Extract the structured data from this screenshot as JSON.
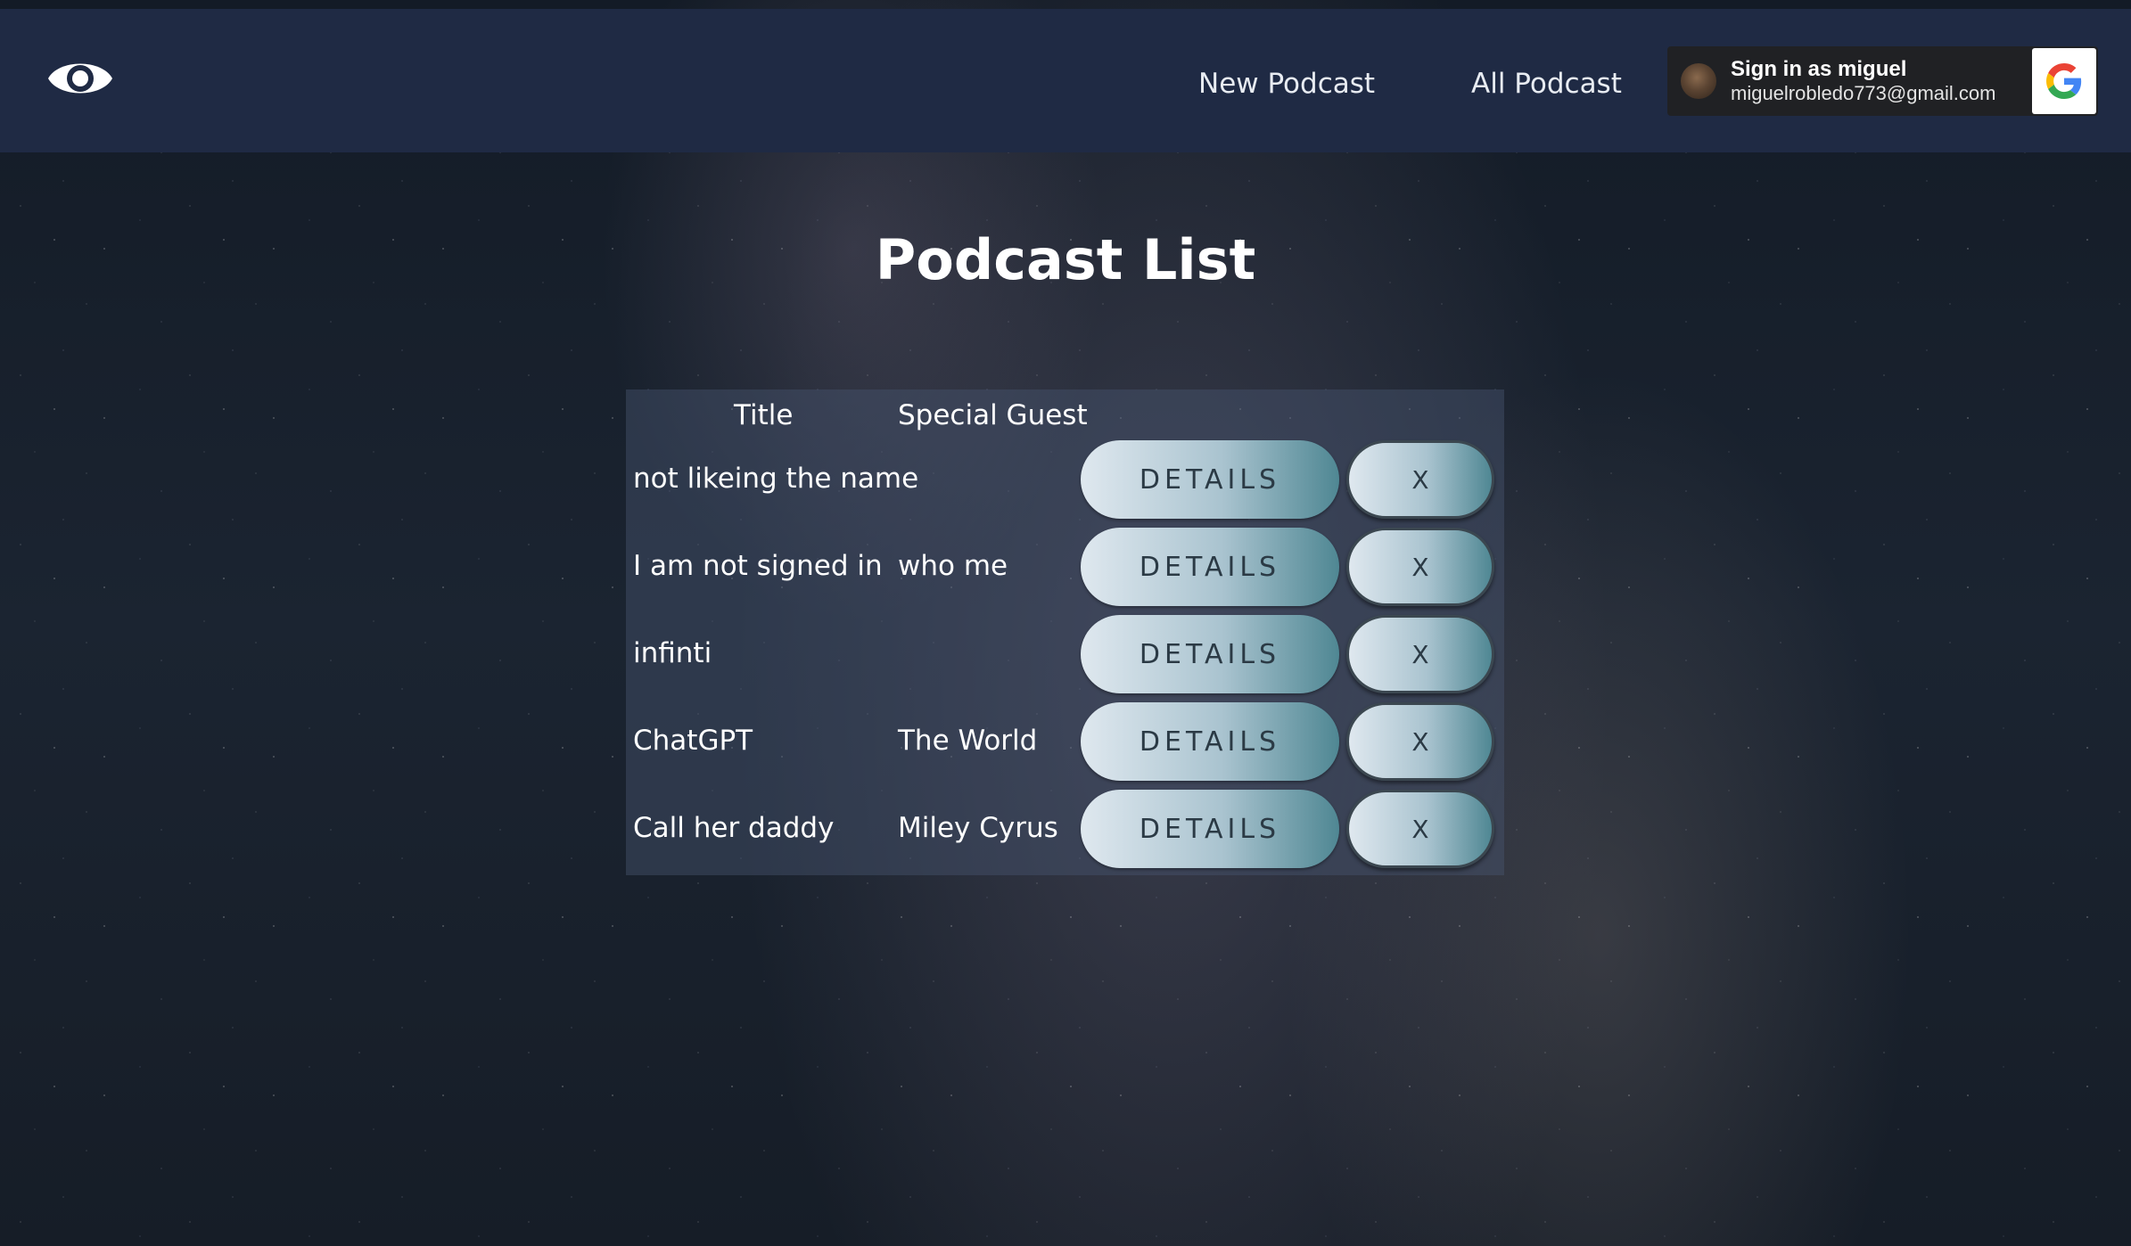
{
  "nav": {
    "logo_icon": "eye-icon",
    "links": [
      "New Podcast",
      "All Podcast"
    ]
  },
  "signin": {
    "label": "Sign in as miguel",
    "email": "miguelrobledo773@gmail.com",
    "provider_icon": "google-icon"
  },
  "page": {
    "title": "Podcast List"
  },
  "table": {
    "headers": [
      "Title",
      "Special Guest"
    ],
    "rows": [
      {
        "title": "not likeing the name",
        "guest": "",
        "details": "DETAILS",
        "delete": "X"
      },
      {
        "title": "I am not signed in",
        "guest": "who me",
        "details": "DETAILS",
        "delete": "X"
      },
      {
        "title": "infinti",
        "guest": "",
        "details": "DETAILS",
        "delete": "X"
      },
      {
        "title": "ChatGPT",
        "guest": "The World",
        "details": "DETAILS",
        "delete": "X"
      },
      {
        "title": "Call her daddy",
        "guest": "Miley Cyrus",
        "details": "DETAILS",
        "delete": "X"
      }
    ]
  },
  "colors": {
    "navbar": "#1f2a44",
    "signin_bg": "#202124",
    "button_light": "#dfe8ef",
    "button_dark": "#4f8793"
  }
}
